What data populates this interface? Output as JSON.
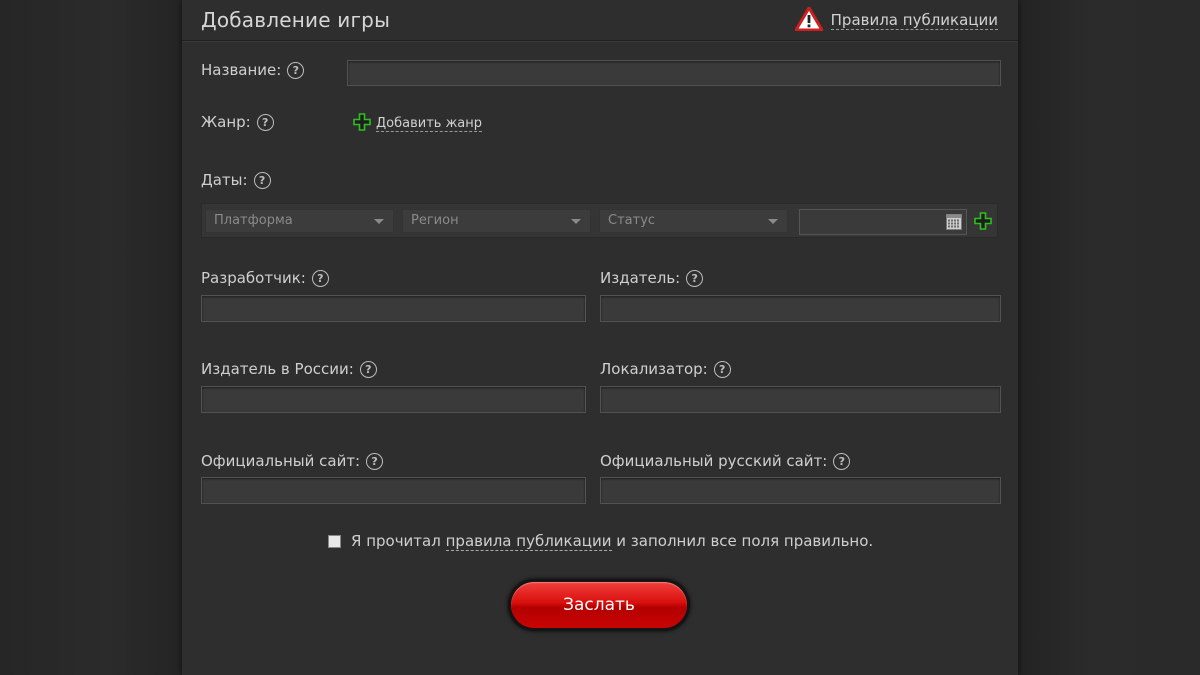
{
  "header": {
    "title": "Добавление игры",
    "rules_link": "Правила публикации"
  },
  "fields": {
    "name": {
      "label": "Название:",
      "value": ""
    },
    "genre": {
      "label": "Жанр:",
      "add_label": "Добавить жанр"
    },
    "dates": {
      "label": "Даты:",
      "platform_placeholder": "Платформа",
      "region_placeholder": "Регион",
      "status_placeholder": "Статус",
      "date_value": ""
    },
    "developer": {
      "label": "Разработчик:",
      "value": ""
    },
    "publisher": {
      "label": "Издатель:",
      "value": ""
    },
    "publisher_russia": {
      "label": "Издатель в России:",
      "value": ""
    },
    "localizer": {
      "label": "Локализатор:",
      "value": ""
    },
    "official_site": {
      "label": "Официальный сайт:",
      "value": ""
    },
    "official_ru_site": {
      "label": "Официальный русский сайт:",
      "value": ""
    }
  },
  "agreement": {
    "prefix": "Я прочитал",
    "link": "правила публикации",
    "suffix": "и заполнил все поля правильно.",
    "checked": false
  },
  "submit_label": "Заслать",
  "help_glyph": "?",
  "colors": {
    "background": "#292929",
    "panel": "#2e2e2e",
    "accent_red": "#d90f0c",
    "plus_green": "#2fbf1f",
    "warning_red": "#cc2020"
  },
  "icons": {
    "warning": "warning-icon",
    "help": "help-icon",
    "add": "plus-icon",
    "calendar": "calendar-icon",
    "dropdown": "chevron-down-icon"
  }
}
